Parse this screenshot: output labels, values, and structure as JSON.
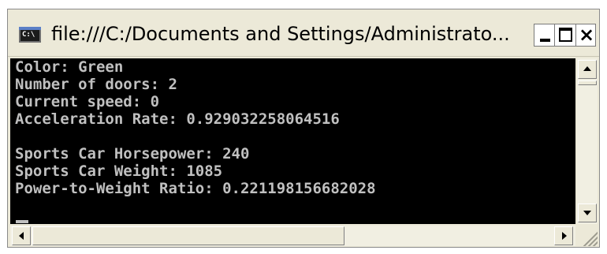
{
  "window": {
    "title": "file:///C:/Documents and Settings/Administrato...",
    "icon": "console-icon",
    "icon_text": "C:\\",
    "controls": {
      "minimize": "minimize-icon",
      "maximize": "maximize-icon",
      "close": "×"
    }
  },
  "console": {
    "lines": [
      "Color: Green",
      "Number of doors: 2",
      "Current speed: 0",
      "Acceleration Rate: 0.929032258064516",
      "",
      "Sports Car Horsepower: 240",
      "Sports Car Weight: 1085",
      "Power-to-Weight Ratio: 0.221198156682028"
    ],
    "colors": {
      "background": "#000000",
      "text": "#c0c0c0"
    }
  },
  "scrollbars": {
    "vertical_position": 0.0,
    "horizontal_position": 0.0
  }
}
